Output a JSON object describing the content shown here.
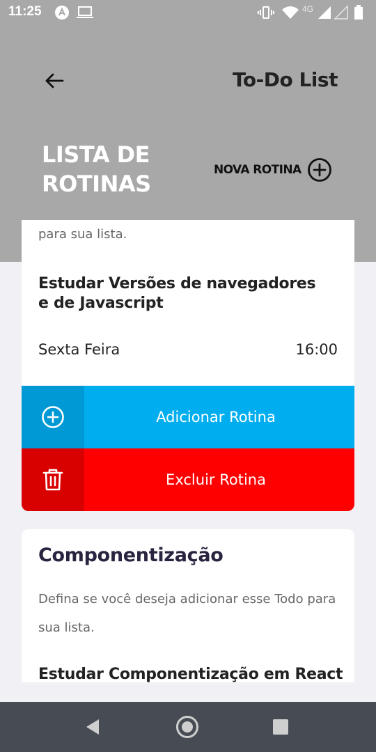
{
  "status_bar": {
    "time": "11:25",
    "network": "4G",
    "icons": [
      "app-notification-icon",
      "screen-cast-icon",
      "vibrate-icon",
      "wifi-icon",
      "signal-icon",
      "battery-icon"
    ]
  },
  "header": {
    "app_title": "To-Do List",
    "page_title": "LISTA DE ROTINAS",
    "new_routine_label": "NOVA ROTINA"
  },
  "cards": [
    {
      "description": "para sua lista.",
      "task": "Estudar Versões de navegadores e de Javascript",
      "day": "Sexta Feira",
      "time": "16:00",
      "add_label": "Adicionar Rotina",
      "delete_label": "Excluir Rotina"
    },
    {
      "title": "Componentização",
      "description": "Defina se você deseja adicionar esse Todo para sua lista.",
      "task": "Estudar Componentização em React"
    }
  ],
  "colors": {
    "header_bg": "#a8a8a8",
    "add_button": "#00aeef",
    "delete_button": "#ff0000",
    "page_bg": "#f0f0f5",
    "nav_bar": "#474c54"
  }
}
